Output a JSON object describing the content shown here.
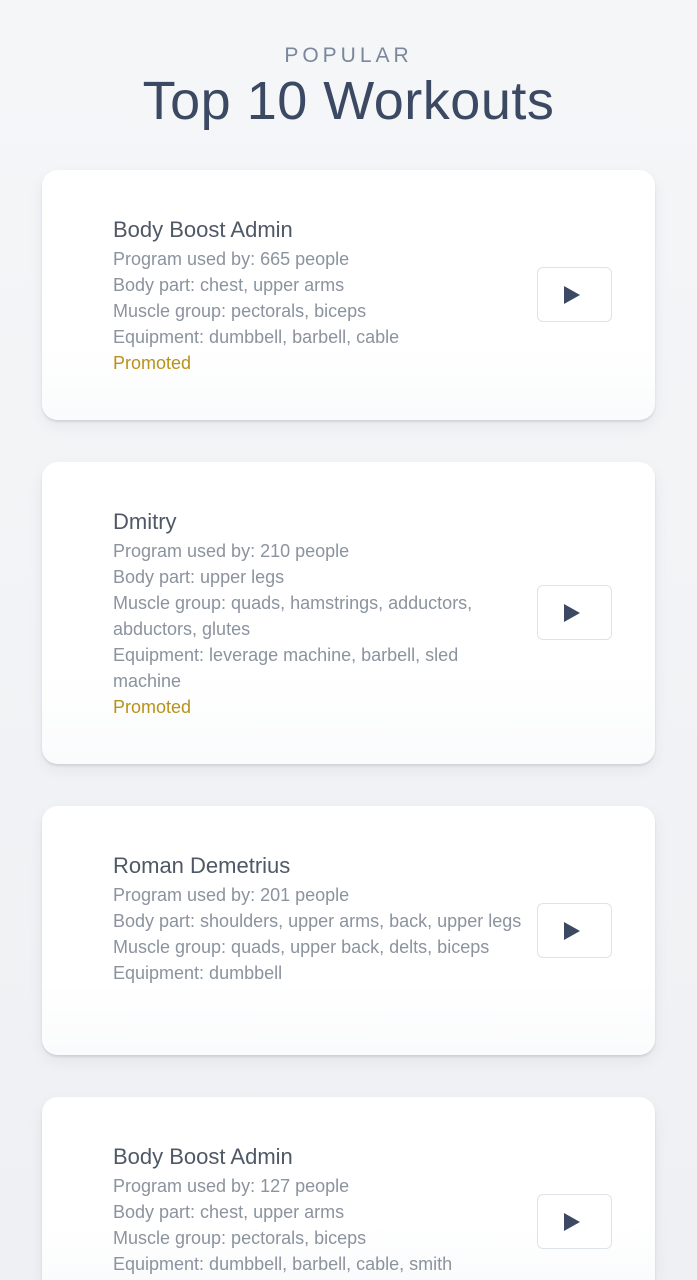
{
  "header": {
    "eyebrow": "POPULAR",
    "title": "Top 10 Workouts"
  },
  "colors": {
    "title": "#3b4a62",
    "promoted": "#b8911a",
    "muted_text": "#8b939e"
  },
  "icons": {
    "play": "play-icon"
  },
  "workouts": [
    {
      "name": "Body Boost Admin",
      "used_by": "Program used by: 665 people",
      "body_part": "Body part: chest, upper arms",
      "muscle_group": "Muscle group: pectorals, biceps",
      "equipment": "Equipment: dumbbell, barbell, cable",
      "badge": "Promoted"
    },
    {
      "name": "Dmitry",
      "used_by": "Program used by: 210 people",
      "body_part": "Body part: upper legs",
      "muscle_group": "Muscle group: quads, hamstrings, adductors, abductors, glutes",
      "equipment": "Equipment: leverage machine, barbell, sled machine",
      "badge": "Promoted"
    },
    {
      "name": "Roman Demetrius",
      "used_by": "Program used by: 201 people",
      "body_part": "Body part: shoulders, upper arms, back, upper legs",
      "muscle_group": "Muscle group: quads, upper back, delts, biceps",
      "equipment": "Equipment: dumbbell"
    },
    {
      "name": "Body Boost Admin",
      "used_by": "Program used by: 127 people",
      "body_part": "Body part: chest, upper arms",
      "muscle_group": "Muscle group: pectorals, biceps",
      "equipment": "Equipment: dumbbell, barbell, cable, smith"
    }
  ]
}
